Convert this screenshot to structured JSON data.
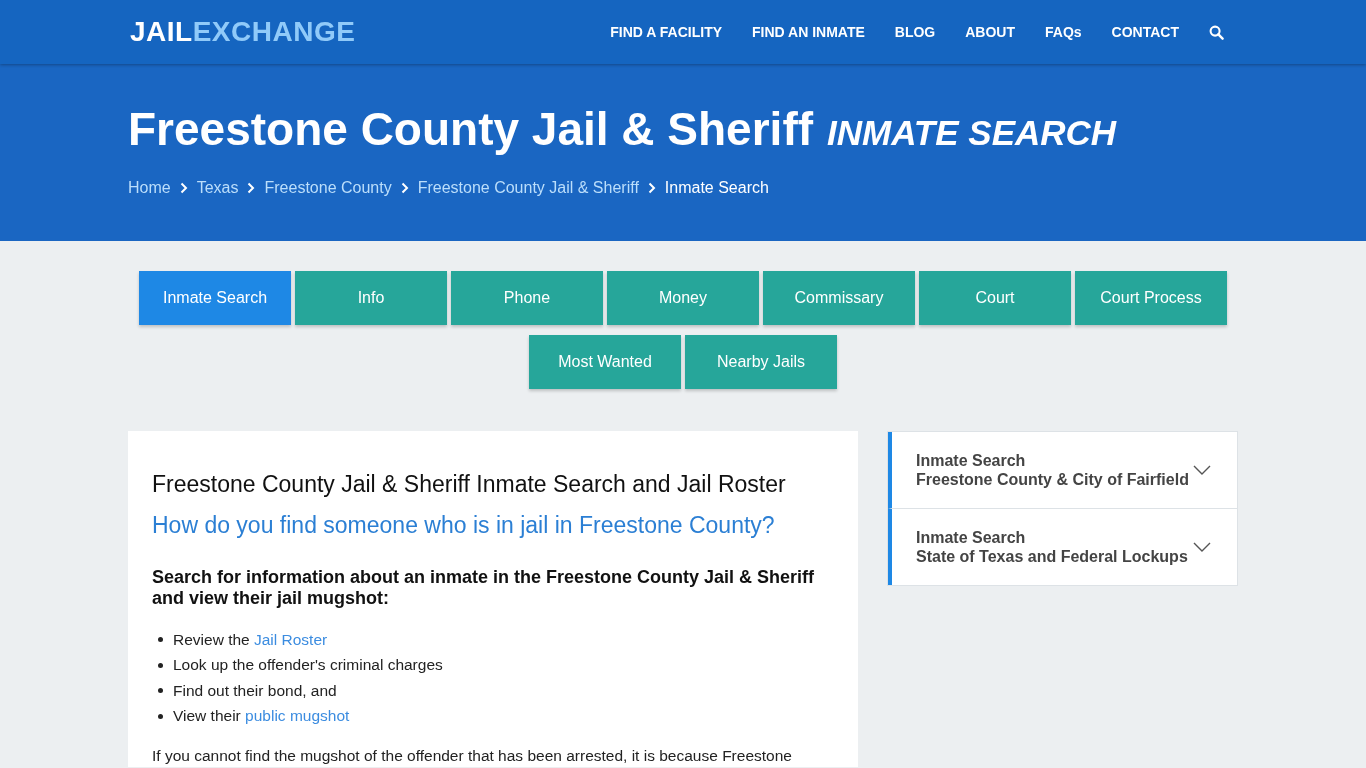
{
  "logo": {
    "part_1": "JAIL",
    "part_2": "EXCHANGE"
  },
  "nav": {
    "items": [
      "FIND A FACILITY",
      "FIND AN INMATE",
      "BLOG",
      "ABOUT",
      "FAQs",
      "CONTACT"
    ]
  },
  "hero": {
    "title": "Freestone County Jail & Sheriff",
    "subtitle": "INMATE SEARCH",
    "breadcrumbs": [
      {
        "label": "Home",
        "current": false
      },
      {
        "label": "Texas",
        "current": false
      },
      {
        "label": "Freestone County",
        "current": false
      },
      {
        "label": "Freestone County Jail & Sheriff",
        "current": false
      },
      {
        "label": "Inmate Search",
        "current": true
      }
    ]
  },
  "tabs": [
    {
      "label": "Inmate Search",
      "selected": true
    },
    {
      "label": "Info",
      "selected": false
    },
    {
      "label": "Phone",
      "selected": false
    },
    {
      "label": "Money",
      "selected": false
    },
    {
      "label": "Commissary",
      "selected": false
    },
    {
      "label": "Court",
      "selected": false
    },
    {
      "label": "Court Process",
      "selected": false
    },
    {
      "label": "Most Wanted",
      "selected": false
    },
    {
      "label": "Nearby Jails",
      "selected": false
    }
  ],
  "article": {
    "heading": "Freestone County Jail & Sheriff Inmate Search and Jail Roster",
    "question": "How do you find someone who is in jail in Freestone County?",
    "intro": "Search for information about an inmate in the Freestone County Jail & Sheriff and view their jail mugshot:",
    "list": [
      {
        "text": "Review the ",
        "link": "Jail Roster"
      },
      {
        "text": "Look up the offender's criminal charges"
      },
      {
        "text": "Find out their bond, and"
      },
      {
        "text": "View their ",
        "link": "public mugshot"
      }
    ],
    "paragraph": "If you cannot find the mugshot of the offender that has been arrested, it is because Freestone"
  },
  "sidebar": {
    "items": [
      {
        "line_1": "Inmate Search",
        "line_2": "Freestone County & City of Fairfield",
        "expanded": false
      },
      {
        "line_1": "Inmate Search",
        "line_2": "State of Texas and Federal Lockups",
        "expanded": false
      }
    ]
  }
}
